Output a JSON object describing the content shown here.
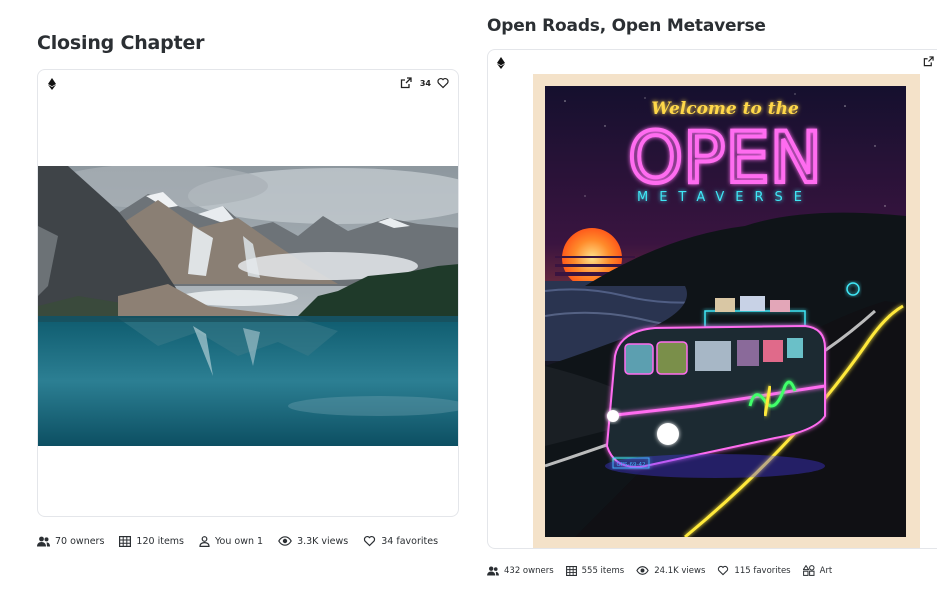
{
  "collections": [
    {
      "title": "Closing Chapter",
      "favorite_count": "34",
      "artwork": "mountain-lake-photo",
      "stats": [
        {
          "icon": "owners-icon",
          "label": "70 owners"
        },
        {
          "icon": "items-grid-icon",
          "label": "120 items"
        },
        {
          "icon": "person-icon",
          "label": "You own 1"
        },
        {
          "icon": "eye-icon",
          "label": "3.3K views"
        },
        {
          "icon": "heart-icon",
          "label": "34 favorites"
        }
      ]
    },
    {
      "title": "Open Roads, Open Metaverse",
      "artwork": "neon-van-poster",
      "poster_text": {
        "welcome": "Welcome to the",
        "open": "OPEN",
        "metaverse": "METAVERSE",
        "plate": "GPS-69-42"
      },
      "stats": [
        {
          "icon": "owners-icon",
          "label": "432 owners"
        },
        {
          "icon": "items-grid-icon",
          "label": "555 items"
        },
        {
          "icon": "eye-icon",
          "label": "24.1K views"
        },
        {
          "icon": "heart-icon",
          "label": "115 favorites"
        },
        {
          "icon": "shapes-icon",
          "label": "Art"
        }
      ]
    }
  ],
  "colors": {
    "neon_pink": "#ff6cf0",
    "neon_cyan": "#3fe6f5",
    "neon_yellow": "#ffe93a",
    "poster_frame": "#f4e2c9"
  }
}
